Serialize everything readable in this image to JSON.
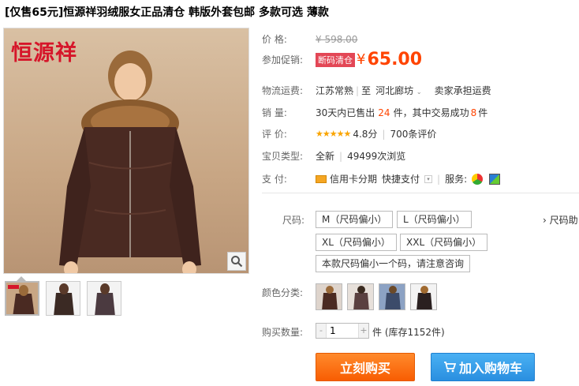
{
  "title": "[仅售65元]恒源祥羽绒服女正品清仓 韩版外套包邮 多款可选 薄款",
  "brand_logo": "恒源祥",
  "price": {
    "label": "价    格:",
    "original": "¥ 598.00"
  },
  "promo": {
    "label": "参加促销:",
    "tag": "断码清仓",
    "currency": "¥",
    "value": "65.00"
  },
  "shipping": {
    "label": "物流运费:",
    "from": "江苏常熟",
    "to_prefix": "至",
    "to": "河北廊坊",
    "fee": "卖家承担运费"
  },
  "sales": {
    "label": "销    量:",
    "prefix": "30天内已售出",
    "count": "24",
    "mid": "件，其中交易成功",
    "success": "8",
    "suffix": "件"
  },
  "rating": {
    "label": "评    价:",
    "stars": "★★★★★",
    "score": "4.8分",
    "reviews": "700条评价"
  },
  "type": {
    "label": "宝贝类型:",
    "condition": "全新",
    "views": "49499次浏览"
  },
  "payment": {
    "label": "支    付:",
    "credit": "信用卡分期",
    "quick": "快捷支付",
    "service_label": "服务:"
  },
  "size": {
    "label": "尺码:",
    "helper": "› 尺码助",
    "options": [
      "M（尺码偏小）",
      "L（尺码偏小）",
      "XL（尺码偏小）",
      "XXL（尺码偏小）",
      "本款尺码偏小一个码，请注意咨询"
    ]
  },
  "color": {
    "label": "颜色分类:"
  },
  "quantity": {
    "label": "购买数量:",
    "value": "1",
    "stock": "件 (库存1152件)",
    "minus": "-",
    "plus": "+"
  },
  "buttons": {
    "buy": "立刻购买",
    "cart": "加入购物车"
  },
  "colors": {
    "accent": "#ff4400",
    "buy": "#f85d02",
    "cart": "#2a8fe0",
    "promo_tag": "#e34756"
  }
}
